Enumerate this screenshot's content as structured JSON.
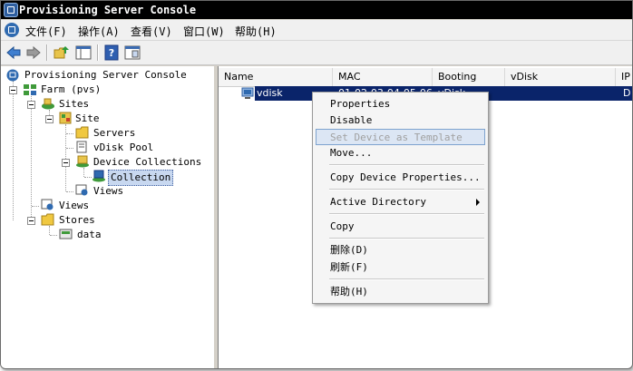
{
  "window": {
    "title": "Provisioning Server Console"
  },
  "menubar": {
    "items": [
      {
        "label": "文件(F)"
      },
      {
        "label": "操作(A)"
      },
      {
        "label": "查看(V)"
      },
      {
        "label": "窗口(W)"
      },
      {
        "label": "帮助(H)"
      }
    ]
  },
  "toolbar": {
    "buttons": [
      "back-icon",
      "forward-icon",
      "up-folder-icon",
      "show-tree-icon",
      "help-icon",
      "properties-icon"
    ]
  },
  "tree": {
    "root": "Provisioning Server Console",
    "farm": "Farm (pvs)",
    "sites": "Sites",
    "site": "Site",
    "servers": "Servers",
    "vdisk_pool": "vDisk Pool",
    "device_collections": "Device Collections",
    "collection": "Collection",
    "views_site": "Views",
    "views_farm": "Views",
    "stores": "Stores",
    "data": "data"
  },
  "list": {
    "columns": [
      "Name",
      "MAC",
      "Booting From",
      "vDisk",
      "IP"
    ],
    "rows": [
      {
        "name": "vdisk",
        "mac": "01-02-03-04-05-06",
        "booting_from": "vDisk",
        "vdisk": "",
        "ip": "D"
      }
    ]
  },
  "context_menu": {
    "items": [
      {
        "label": "Properties"
      },
      {
        "label": "Disable"
      },
      {
        "label": "Set Device as Template"
      },
      {
        "label": "Move..."
      },
      {
        "label": "Copy Device Properties..."
      },
      {
        "label": "Active Directory"
      },
      {
        "label": "Copy"
      },
      {
        "label": "删除(D)"
      },
      {
        "label": "刷新(F)"
      },
      {
        "label": "帮助(H)"
      }
    ]
  },
  "colors": {
    "selection": "#0a246a",
    "hover": "#dce6f4"
  }
}
